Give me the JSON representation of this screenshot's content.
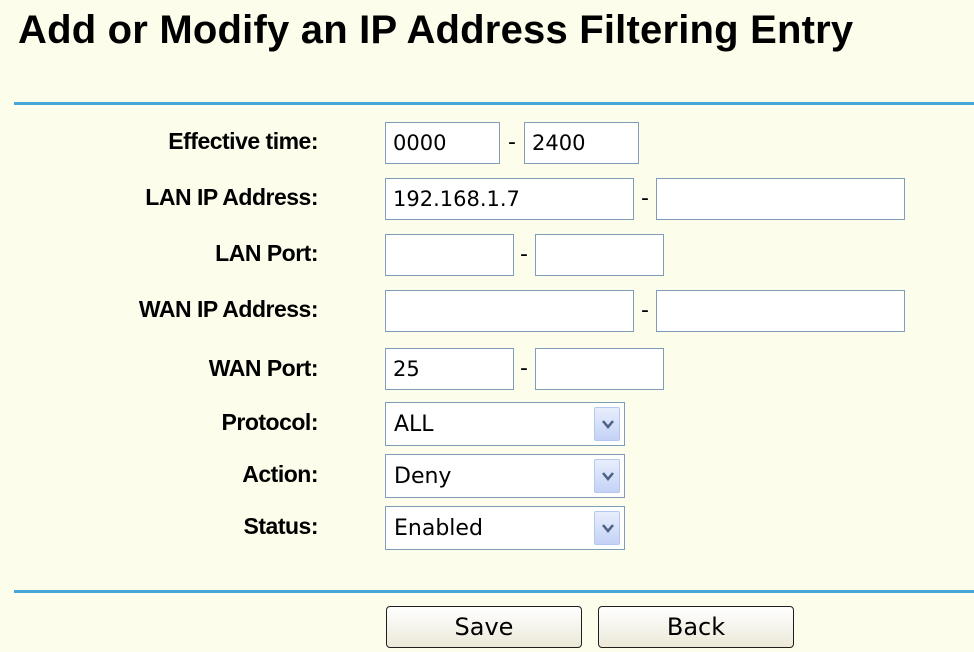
{
  "page": {
    "title": "Add or Modify an IP Address Filtering Entry"
  },
  "form": {
    "effective_time": {
      "label": "Effective time:",
      "start": "0000",
      "end": "2400"
    },
    "lan_ip": {
      "label": "LAN IP Address:",
      "start": "192.168.1.7",
      "end": ""
    },
    "lan_port": {
      "label": "LAN Port:",
      "start": "",
      "end": ""
    },
    "wan_ip": {
      "label": "WAN IP Address:",
      "start": "",
      "end": ""
    },
    "wan_port": {
      "label": "WAN Port:",
      "start": "25",
      "end": ""
    },
    "protocol": {
      "label": "Protocol:",
      "value": "ALL"
    },
    "action": {
      "label": "Action:",
      "value": "Deny"
    },
    "status": {
      "label": "Status:",
      "value": "Enabled"
    },
    "separator": "-"
  },
  "buttons": {
    "save": "Save",
    "back": "Back"
  },
  "colors": {
    "background": "#fdfdec",
    "rule": "#4aa6d8",
    "field_border": "#7f9db9"
  },
  "icons": {
    "dropdown": "chevron-down-icon"
  }
}
